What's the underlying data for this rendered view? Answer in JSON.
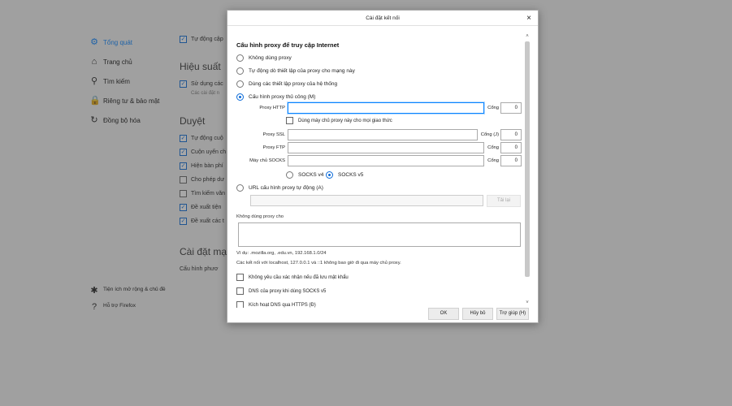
{
  "sidebar": {
    "items": [
      {
        "label": "Tổng quát",
        "icon": "gear-icon",
        "glyph": "⚙",
        "active": true
      },
      {
        "label": "Trang chủ",
        "icon": "home-icon",
        "glyph": "⌂"
      },
      {
        "label": "Tìm kiếm",
        "icon": "search-icon",
        "glyph": "⚲"
      },
      {
        "label": "Riêng tư & bảo mật",
        "icon": "lock-icon",
        "glyph": "🔒"
      },
      {
        "label": "Đồng bộ hóa",
        "icon": "sync-icon",
        "glyph": "↻"
      }
    ],
    "bottom": [
      {
        "label": "Tiện ích mở rộng & chủ đề",
        "icon": "puzzle-icon",
        "glyph": "✱"
      },
      {
        "label": "Hỗ trợ Firefox",
        "icon": "help-icon",
        "glyph": "?"
      }
    ]
  },
  "main": {
    "top_checkbox": "Tự động cập",
    "performance_title": "Hiệu suất",
    "performance_cb": "Sử dụng các",
    "performance_note": "Các cài đặt n",
    "browsing_title": "Duyệt",
    "browsing_items": [
      {
        "label": "Tự động cuộ",
        "checked": true
      },
      {
        "label": "Cuộn uyển ch",
        "checked": true
      },
      {
        "label": "Hiện bàn phí",
        "checked": true
      },
      {
        "label": "Cho phép dư",
        "checked": false
      },
      {
        "label": "Tìm kiếm văn",
        "checked": false
      },
      {
        "label": "Đề xuất tiện",
        "checked": true
      },
      {
        "label": "Đề xuất các t",
        "checked": true
      }
    ],
    "network_title": "Cài đặt mạn",
    "network_desc": "Cấu hình phươ"
  },
  "dialog": {
    "title": "Cài đặt kết nối",
    "close_glyph": "×",
    "group_title": "Cấu hình proxy để truy cập Internet",
    "radios": [
      {
        "label": "Không dùng proxy",
        "selected": false
      },
      {
        "label": "Tự động dò thiết lập của proxy cho mạng này",
        "selected": false
      },
      {
        "label": "Dùng các thiết lập proxy của hệ thống",
        "selected": false
      },
      {
        "label": "Cấu hình proxy thủ công (M)",
        "selected": true
      }
    ],
    "http_label": "Proxy HTTP",
    "http_value": "",
    "port_label": "Cổng",
    "http_port": "0",
    "use_all_label": "Dùng máy chủ proxy này cho mọi giao thức",
    "ssl_label": "Proxy SSL",
    "ssl_value": "",
    "ssl_port_label": "Cổng (J)",
    "ssl_port": "0",
    "ftp_label": "Proxy FTP",
    "ftp_value": "",
    "ftp_port_label": "Cổng",
    "ftp_port": "0",
    "socks_label": "Máy chủ SOCKS",
    "socks_value": "",
    "socks_port_label": "Cổng",
    "socks_port": "0",
    "socks4_label": "SOCKS v4",
    "socks5_label": "SOCKS v5",
    "auto_url_label": "URL cấu hình proxy tự động (A)",
    "auto_url_value": "",
    "reload_label": "Tải lại",
    "no_proxy_label": "Không dùng proxy cho",
    "no_proxy_value": "",
    "example_note": "Ví dụ: .mozilla.org, .edu.vn, 192.168.1.0/24",
    "localhost_note": "Các kết nối với localhost, 127.0.0.1 và ::1 không bao giờ đi qua máy chủ proxy.",
    "auth_label": "Không yêu cầu xác nhận nếu đã lưu mật khẩu",
    "dns_label": "DNS của proxy khi dùng SOCKS v5",
    "doh_label": "Kích hoạt DNS qua HTTPS (Đ)",
    "scroll_up": "˄",
    "scroll_down": "˅",
    "ok_label": "OK",
    "cancel_label": "Hủy bỏ",
    "help_label": "Trợ giúp (H)"
  }
}
